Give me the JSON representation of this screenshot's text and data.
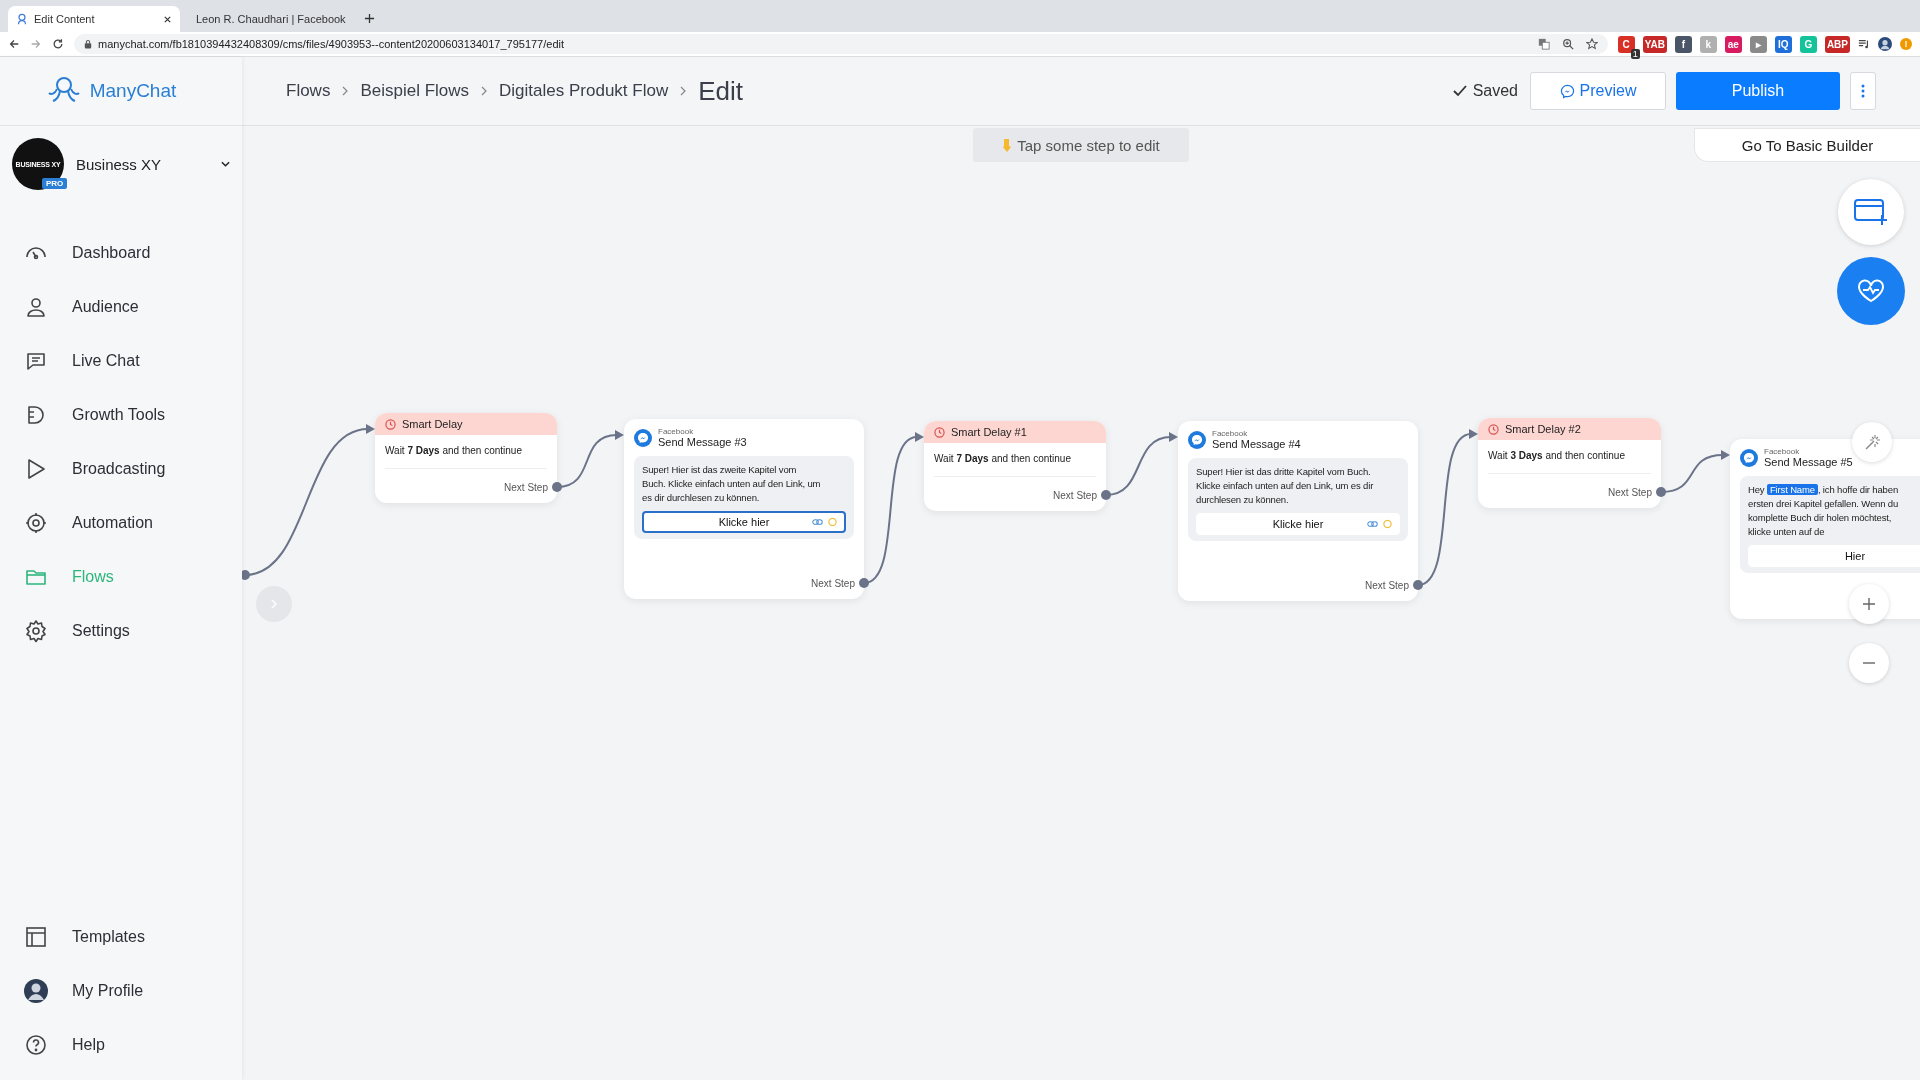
{
  "browser": {
    "tabs": [
      {
        "title": "Edit Content",
        "selected": true
      },
      {
        "title": "Leon R. Chaudhari | Facebook",
        "selected": false
      }
    ],
    "url": "manychat.com/fb1810394432408309/cms/files/4903953--content20200603134017_795177/edit",
    "extensions": [
      {
        "color": "#d93025",
        "label": "C",
        "badge": "1"
      },
      {
        "color": "#c62828",
        "label": "YAB"
      },
      {
        "color": "#4a5568",
        "label": "f"
      },
      {
        "color": "#b0b0b0",
        "label": "k"
      },
      {
        "color": "#d81b60",
        "label": "ae"
      },
      {
        "color": "#8a8a8a",
        "label": "▸"
      },
      {
        "color": "#1e6fd9",
        "label": "IQ"
      },
      {
        "color": "#15c39a",
        "label": "G"
      },
      {
        "color": "#c62828",
        "label": "ABP"
      }
    ],
    "update_badge": "!"
  },
  "sidebar": {
    "logo": "ManyChat",
    "account": {
      "avatar_text": "BUSINESS XY",
      "badge": "PRO",
      "name": "Business XY"
    },
    "nav": [
      {
        "label": "Dashboard",
        "selected": false
      },
      {
        "label": "Audience",
        "selected": false
      },
      {
        "label": "Live Chat",
        "selected": false
      },
      {
        "label": "Growth Tools",
        "selected": false
      },
      {
        "label": "Broadcasting",
        "selected": false
      },
      {
        "label": "Automation",
        "selected": false
      },
      {
        "label": "Flows",
        "selected": true
      },
      {
        "label": "Settings",
        "selected": false
      }
    ],
    "bottom_nav": [
      {
        "label": "Templates"
      },
      {
        "label": "My Profile"
      },
      {
        "label": "Help"
      }
    ]
  },
  "header": {
    "breadcrumbs": [
      "Flows",
      "Beispiel Flows",
      "Digitales Produkt Flow"
    ],
    "title": "Edit",
    "status": "Saved",
    "preview": "Preview",
    "publish": "Publish"
  },
  "canvas": {
    "hint": "Tap some step to edit",
    "basic_builder": "Go To Basic Builder",
    "nodes": [
      {
        "kind": "delay",
        "title": "Smart Delay",
        "text": "Wait **7 Days** and then continue",
        "next": "Next Step"
      },
      {
        "kind": "message",
        "channel": "Facebook",
        "title": "Send Message #3",
        "lines": [
          [
            {
              "kind": "text",
              "text": "Super! Hier ist das zweite Kapitel vom"
            }
          ],
          [
            {
              "kind": "text",
              "text": "Buch. Klicke einfach unten auf den Link, um"
            }
          ],
          [
            {
              "kind": "text",
              "text": "es dir durchlesen zu können."
            }
          ]
        ],
        "button": "Klicke hier",
        "button_selected": true,
        "button_icons": true,
        "next": "Next Step"
      },
      {
        "kind": "delay",
        "title": "Smart Delay #1",
        "text": "Wait **7 Days** and then continue",
        "next": "Next Step"
      },
      {
        "kind": "message",
        "channel": "Facebook",
        "title": "Send Message #4",
        "lines": [
          [
            {
              "kind": "text",
              "text": "Super! Hier ist das dritte Kapitel vom Buch."
            }
          ],
          [
            {
              "kind": "text",
              "text": "Klicke einfach unten auf den Link, um es dir"
            }
          ],
          [
            {
              "kind": "text",
              "text": "durchlesen zu können."
            }
          ]
        ],
        "button": "Klicke hier",
        "button_selected": false,
        "button_icons": true,
        "next": "Next Step"
      },
      {
        "kind": "delay",
        "title": "Smart Delay #2",
        "text": "Wait **3 Days** and then continue",
        "next": "Next Step"
      },
      {
        "kind": "message",
        "channel": "Facebook",
        "title": "Send Message #5",
        "lines": [
          [
            {
              "kind": "text",
              "text": "Hey "
            },
            {
              "kind": "variable",
              "text": "First Name"
            },
            {
              "kind": "text",
              "text": ", ich hoffe dir haben"
            }
          ],
          [
            {
              "kind": "text",
              "text": "ersten drei Kapitel gefallen. Wenn du"
            }
          ],
          [
            {
              "kind": "text",
              "text": "komplette Buch dir holen möchtest,"
            }
          ],
          [
            {
              "kind": "text",
              "text": "klicke unten auf de"
            }
          ]
        ],
        "button": "Hier",
        "button_selected": false
      }
    ]
  }
}
